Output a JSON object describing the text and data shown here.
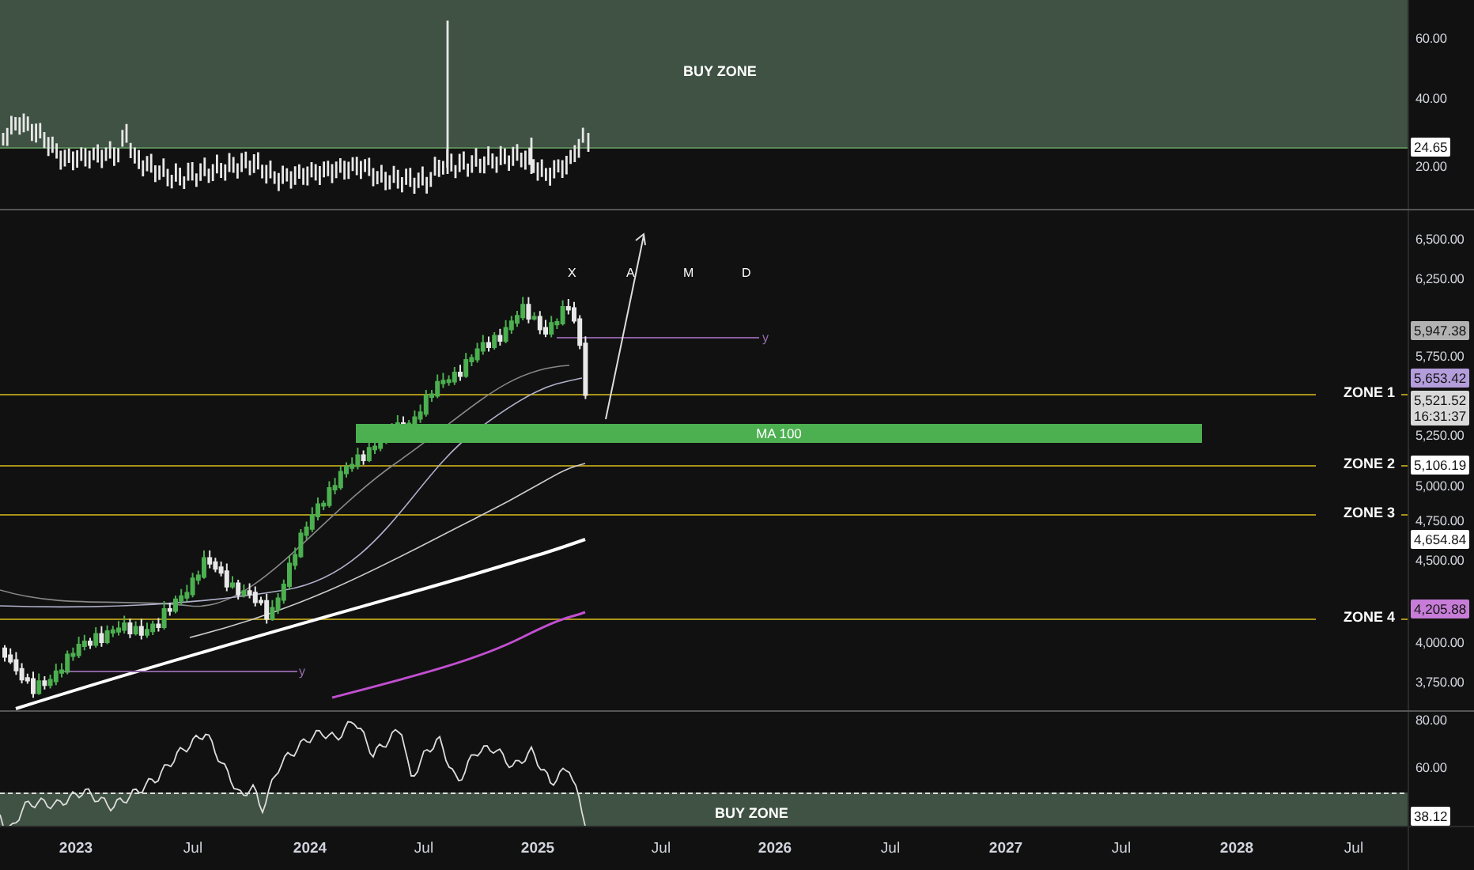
{
  "volatility_pane": {
    "zone_label": "BUY ZONE",
    "axis_labels": [
      "60.00",
      "40.00",
      "20.00"
    ],
    "badges": [
      {
        "text": "24.65",
        "color": "#ffffff"
      }
    ]
  },
  "price_pane": {
    "pattern_letters": [
      "X",
      "A",
      "M",
      "D"
    ],
    "line_labels": [
      "y",
      "y"
    ],
    "band_label": "MA 100",
    "zones": [
      {
        "label": "ZONE 1"
      },
      {
        "label": "ZONE 2"
      },
      {
        "label": "ZONE 3"
      },
      {
        "label": "ZONE 4"
      }
    ],
    "axis_labels": [
      "6,500.00",
      "6,250.00",
      "5,750.00",
      "5,250.00",
      "5,000.00",
      "4,750.00",
      "4,500.00",
      "4,000.00",
      "3,750.00"
    ],
    "badges": [
      {
        "text": "5,947.38",
        "color": "#b2b2b2"
      },
      {
        "text": "5,653.42",
        "color": "#b39ddb"
      },
      {
        "text": "5,521.52",
        "subtext": "16:31:37",
        "color": "#d9d9d9"
      },
      {
        "text": "5,106.19",
        "color": "#ffffff"
      },
      {
        "text": "4,654.84",
        "color": "#ffffff"
      },
      {
        "text": "4,205.88",
        "color": "#c77dd8"
      }
    ]
  },
  "rsi_pane": {
    "zone_label": "BUY ZONE",
    "axis_labels": [
      "80.00",
      "60.00"
    ],
    "badges": [
      {
        "text": "38.12",
        "color": "#ffffff"
      }
    ]
  },
  "time_axis": [
    {
      "label": "2023",
      "kind": "year"
    },
    {
      "label": "Jul",
      "kind": "month"
    },
    {
      "label": "2024",
      "kind": "year"
    },
    {
      "label": "Jul",
      "kind": "month"
    },
    {
      "label": "2025",
      "kind": "year"
    },
    {
      "label": "Jul",
      "kind": "month"
    },
    {
      "label": "2026",
      "kind": "year"
    },
    {
      "label": "Jul",
      "kind": "month"
    },
    {
      "label": "2027",
      "kind": "year"
    },
    {
      "label": "Jul",
      "kind": "month"
    },
    {
      "label": "2028",
      "kind": "year"
    },
    {
      "label": "Jul",
      "kind": "month"
    }
  ]
}
